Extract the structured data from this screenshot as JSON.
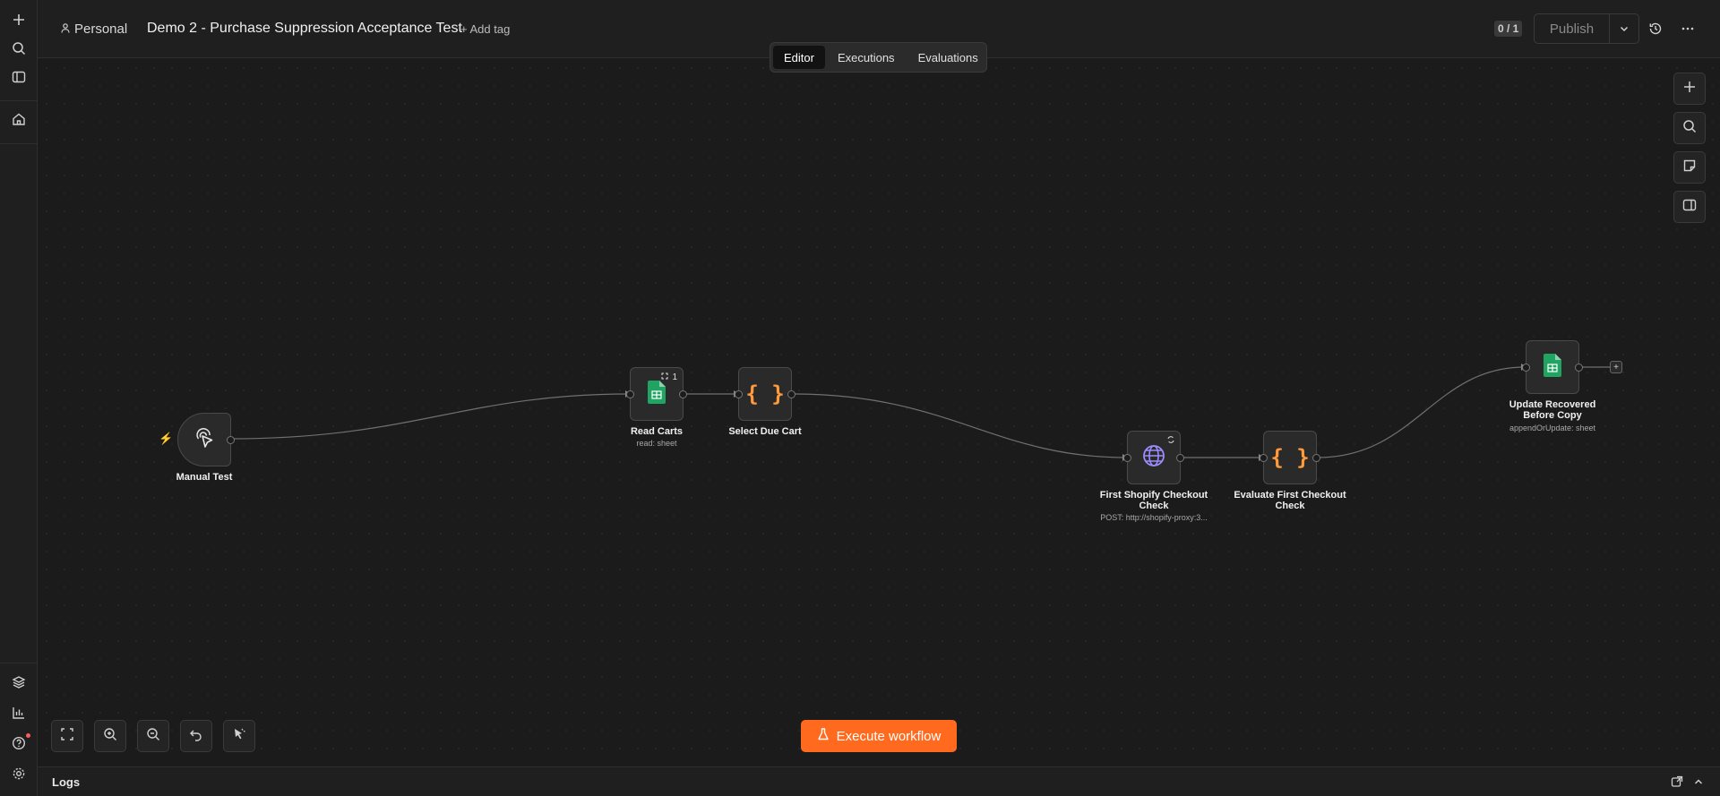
{
  "header": {
    "project": "Personal",
    "workflow_title": "Demo 2 - Purchase Suppression Acceptance Test",
    "add_tag": "+ Add tag",
    "counter": "0 / 1",
    "publish_label": "Publish"
  },
  "tabs": [
    {
      "label": "Editor",
      "active": true
    },
    {
      "label": "Executions",
      "active": false
    },
    {
      "label": "Evaluations",
      "active": false
    }
  ],
  "nodes": {
    "manual_test": {
      "label": "Manual Test"
    },
    "read_carts": {
      "label": "Read Carts",
      "sub": "read: sheet",
      "badge": "1"
    },
    "select_due_cart": {
      "label": "Select Due Cart"
    },
    "first_shopify": {
      "label_line1": "First Shopify Checkout",
      "label_line2": "Check",
      "sub": "POST: http://shopify-proxy:3..."
    },
    "evaluate_first": {
      "label_line1": "Evaluate First Checkout",
      "label_line2": "Check"
    },
    "update_recovered": {
      "label_line1": "Update Recovered",
      "label_line2": "Before Copy",
      "sub": "appendOrUpdate: sheet"
    }
  },
  "execute_button": {
    "label": "Execute workflow"
  },
  "logs": {
    "label": "Logs"
  },
  "colors": {
    "accent": "#ff6a1f",
    "sheets_green": "#1fa463",
    "code_orange": "#ff9a3c",
    "http_purple": "#9b8cff"
  }
}
